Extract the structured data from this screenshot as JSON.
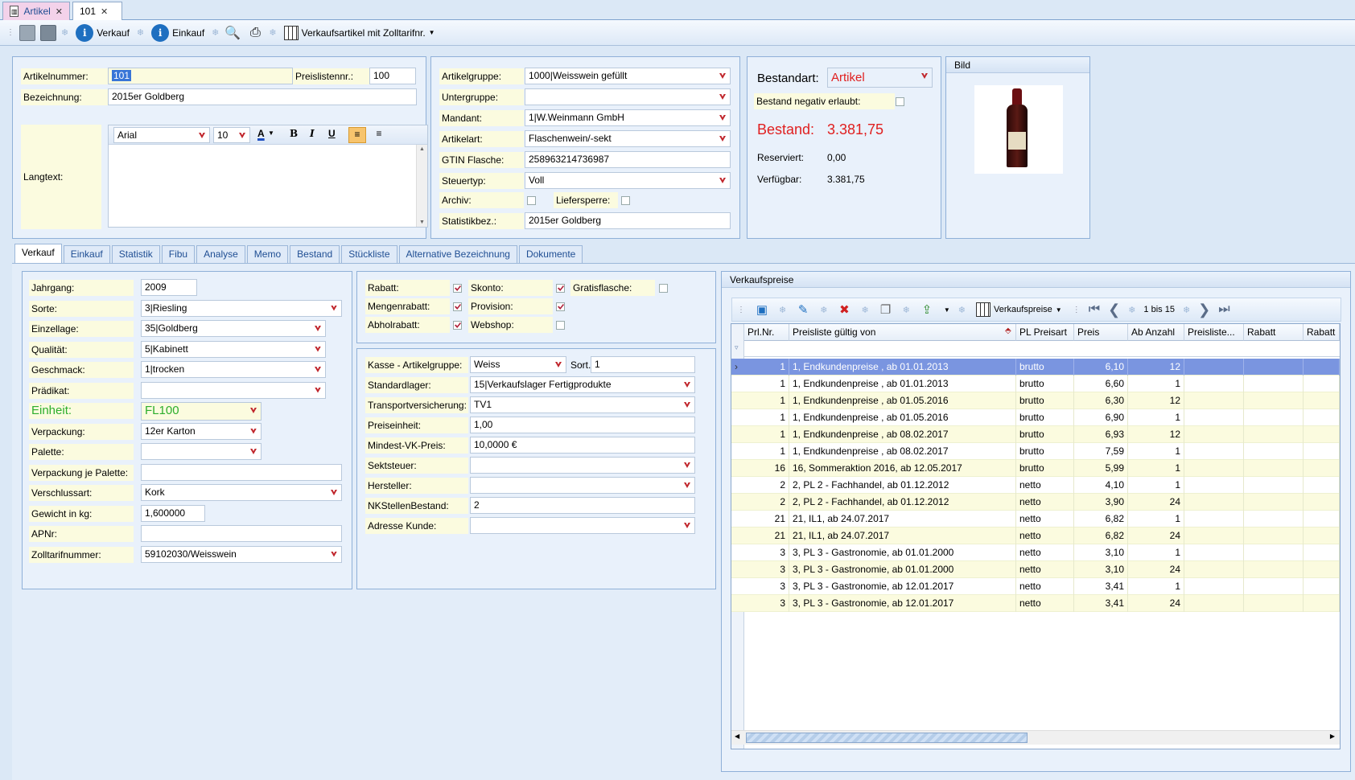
{
  "tabs": [
    {
      "label": "Artikel"
    },
    {
      "label": "101"
    }
  ],
  "toolbar": {
    "verkauf": "Verkauf",
    "einkauf": "Einkauf",
    "view_label": "Verkaufsartikel mit Zolltarifnr."
  },
  "head": {
    "artikelnummer_label": "Artikelnummer:",
    "artikelnummer": "101",
    "preislistennr_label": "Preislistennr.:",
    "preislistennr": "100",
    "bezeichnung_label": "Bezeichnung:",
    "bezeichnung": "2015er Goldberg",
    "langtext_label": "Langtext:",
    "font": "Arial",
    "fontsize": "10"
  },
  "group": {
    "artikelgruppe_label": "Artikelgruppe:",
    "artikelgruppe": "1000|Weisswein gefüllt",
    "untergruppe_label": "Untergruppe:",
    "untergruppe": "",
    "mandant_label": "Mandant:",
    "mandant": "1|W.Weinmann GmbH",
    "artikelart_label": "Artikelart:",
    "artikelart": "Flaschenwein/-sekt",
    "gtin_label": "GTIN Flasche:",
    "gtin": "258963214736987",
    "steuertyp_label": "Steuertyp:",
    "steuertyp": "Voll",
    "archiv_label": "Archiv:",
    "liefersperre_label": "Liefersperre:",
    "statistikbez_label": "Statistikbez.:",
    "statistikbez": "2015er Goldberg"
  },
  "stock": {
    "bestandart_label": "Bestandart:",
    "bestandart": "Artikel",
    "negativ_label": "Bestand negativ erlaubt:",
    "bestand_label": "Bestand:",
    "bestand": "3.381,75",
    "reserviert_label": "Reserviert:",
    "reserviert": "0,00",
    "verfuegbar_label": "Verfügbar:",
    "verfuegbar": "3.381,75"
  },
  "bild": {
    "title": "Bild"
  },
  "maintabs": [
    "Verkauf",
    "Einkauf",
    "Statistik",
    "Fibu",
    "Analyse",
    "Memo",
    "Bestand",
    "Stückliste",
    "Alternative Bezeichnung",
    "Dokumente"
  ],
  "left": [
    {
      "label": "Jahrgang:",
      "value": "2009"
    },
    {
      "label": "Sorte:",
      "value": "3|Riesling"
    },
    {
      "label": "Einzellage:",
      "value": "35|Goldberg"
    },
    {
      "label": "Qualität:",
      "value": "5|Kabinett"
    },
    {
      "label": "Geschmack:",
      "value": "1|trocken"
    },
    {
      "label": "Prädikat:",
      "value": ""
    },
    {
      "label": "Einheit:",
      "value": "FL100"
    },
    {
      "label": "Verpackung:",
      "value": "12er Karton"
    },
    {
      "label": "Palette:",
      "value": ""
    },
    {
      "label": "Verpackung je Palette:",
      "value": ""
    },
    {
      "label": "Verschlussart:",
      "value": "Kork"
    },
    {
      "label": "Gewicht in kg:",
      "value": "1,600000"
    },
    {
      "label": "APNr:",
      "value": ""
    },
    {
      "label": "Zolltarifnummer:",
      "value": "59102030/Weisswein"
    }
  ],
  "checks": {
    "rabatt": "Rabatt:",
    "skonto": "Skonto:",
    "gratis": "Gratisflasche:",
    "mengenrabatt": "Mengenrabatt:",
    "provision": "Provision:",
    "abholrabatt": "Abholrabatt:",
    "webshop": "Webshop:"
  },
  "mid": [
    {
      "label": "Kasse - Artikelgruppe:",
      "value": "Weiss"
    },
    {
      "label": "Standardlager:",
      "value": "15|Verkaufslager Fertigprodukte"
    },
    {
      "label": "Transportversicherung:",
      "value": "TV1"
    },
    {
      "label": "Preiseinheit:",
      "value": "1,00"
    },
    {
      "label": "Mindest-VK-Preis:",
      "value": "10,0000 €"
    },
    {
      "label": "Sektsteuer:",
      "value": ""
    },
    {
      "label": "Hersteller:",
      "value": ""
    },
    {
      "label": "NKStellenBestand:",
      "value": "2"
    },
    {
      "label": "Adresse Kunde:",
      "value": ""
    }
  ],
  "sort": {
    "label": "Sort.",
    "value": "1"
  },
  "prices": {
    "title": "Verkaufspreise",
    "view": "Verkaufspreise",
    "paging": "1 bis 15",
    "columns": [
      "Prl.Nr.",
      "Preisliste gültig von",
      "PL Preisart",
      "Preis",
      "Ab Anzahl",
      "Preisliste...",
      "Rabatt",
      "Rabatt"
    ],
    "rows": [
      [
        "1",
        "1, Endkundenpreise , ab 01.01.2013",
        "brutto",
        "6,10",
        "12"
      ],
      [
        "1",
        "1, Endkundenpreise , ab 01.01.2013",
        "brutto",
        "6,60",
        "1"
      ],
      [
        "1",
        "1, Endkundenpreise , ab 01.05.2016",
        "brutto",
        "6,30",
        "12"
      ],
      [
        "1",
        "1, Endkundenpreise , ab 01.05.2016",
        "brutto",
        "6,90",
        "1"
      ],
      [
        "1",
        "1, Endkundenpreise , ab 08.02.2017",
        "brutto",
        "6,93",
        "12"
      ],
      [
        "1",
        "1, Endkundenpreise , ab 08.02.2017",
        "brutto",
        "7,59",
        "1"
      ],
      [
        "16",
        "16, Sommeraktion 2016, ab 12.05.2017",
        "brutto",
        "5,99",
        "1"
      ],
      [
        "2",
        "2, PL 2 - Fachhandel, ab 01.12.2012",
        "netto",
        "4,10",
        "1"
      ],
      [
        "2",
        "2, PL 2 - Fachhandel, ab 01.12.2012",
        "netto",
        "3,90",
        "24"
      ],
      [
        "21",
        "21, IL1, ab 24.07.2017",
        "netto",
        "6,82",
        "1"
      ],
      [
        "21",
        "21, IL1, ab 24.07.2017",
        "netto",
        "6,82",
        "24"
      ],
      [
        "3",
        "3, PL 3 - Gastronomie, ab 01.01.2000",
        "netto",
        "3,10",
        "1"
      ],
      [
        "3",
        "3, PL 3 - Gastronomie, ab 01.01.2000",
        "netto",
        "3,10",
        "24"
      ],
      [
        "3",
        "3, PL 3 - Gastronomie, ab 12.01.2017",
        "netto",
        "3,41",
        "1"
      ],
      [
        "3",
        "3, PL 3 - Gastronomie, ab 12.01.2017",
        "netto",
        "3,41",
        "24"
      ]
    ]
  },
  "colors": {
    "accent": "#1f4e93",
    "red": "#e02020",
    "green": "#2cae2c",
    "selected": "#7a95e0"
  }
}
